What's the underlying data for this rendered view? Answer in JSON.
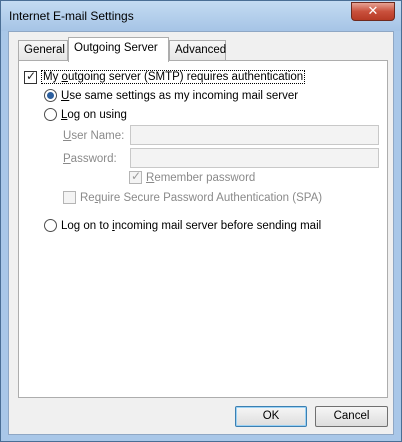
{
  "window": {
    "title": "Internet E-mail Settings",
    "close_glyph": "✕"
  },
  "tabs": [
    {
      "label": "General",
      "active": false
    },
    {
      "label": "Outgoing Server",
      "active": true
    },
    {
      "label": "Advanced",
      "active": false
    }
  ],
  "outgoing": {
    "requires_auth": {
      "pre": "My ",
      "accel": "o",
      "post": "utgoing server (SMTP) requires authentication",
      "checked": true
    },
    "use_same": {
      "accel": "U",
      "post": "se same settings as my incoming mail server",
      "selected": true
    },
    "log_on_using": {
      "accel": "L",
      "post": "og on using",
      "selected": false
    },
    "user_name": {
      "pre": "",
      "accel": "U",
      "post": "ser Name:",
      "value": ""
    },
    "password": {
      "pre": "",
      "accel": "P",
      "post": "assword:",
      "value": ""
    },
    "remember_password": {
      "accel": "R",
      "post": "emember password",
      "checked": true,
      "enabled": false
    },
    "require_spa": {
      "pre": "Re",
      "accel": "q",
      "post": "uire Secure Password Authentication (SPA)",
      "checked": false,
      "enabled": false
    },
    "log_on_incoming": {
      "pre": "Log on to ",
      "accel": "i",
      "post": "ncoming mail server before sending mail",
      "selected": false
    }
  },
  "buttons": {
    "ok": "OK",
    "cancel": "Cancel"
  }
}
